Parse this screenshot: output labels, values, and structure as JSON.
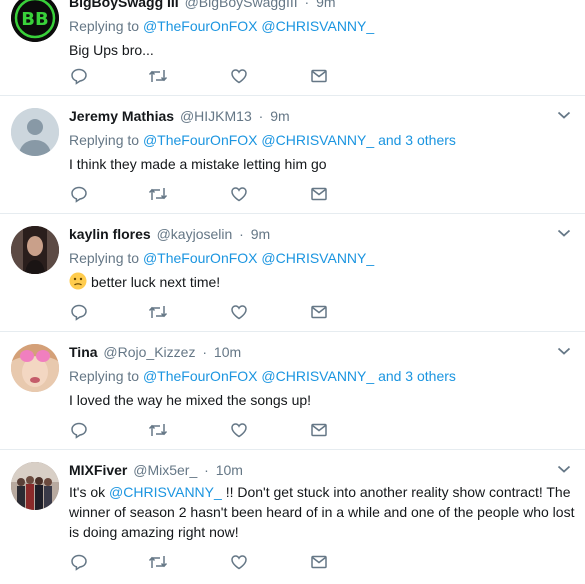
{
  "tweets": [
    {
      "name": "BigBoySwagg III",
      "handle": "@BigBoySwaggIII",
      "time": "9m",
      "replying_prefix": "Replying to",
      "mentions": [
        "@TheFourOnFOX",
        "@CHRISVANNY_"
      ],
      "others": "",
      "text": "Big Ups bro...",
      "avatar": "bb-logo-avatar"
    },
    {
      "name": "Jeremy Mathias",
      "handle": "@HIJKM13",
      "time": "9m",
      "replying_prefix": "Replying to",
      "mentions": [
        "@TheFourOnFOX",
        "@CHRISVANNY_"
      ],
      "others": "and 3 others",
      "text": "I think they made a mistake letting him go",
      "avatar": "default-avatar"
    },
    {
      "name": "kaylin flores",
      "handle": "@kayjoselin",
      "time": "9m",
      "replying_prefix": "Replying to",
      "mentions": [
        "@TheFourOnFOX",
        "@CHRISVANNY_"
      ],
      "others": "",
      "emoji": "confused-face",
      "text": "better luck next time!",
      "avatar": "photo-avatar"
    },
    {
      "name": "Tina",
      "handle": "@Rojo_Kizzez",
      "time": "10m",
      "replying_prefix": "Replying to",
      "mentions": [
        "@TheFourOnFOX",
        "@CHRISVANNY_"
      ],
      "others": "and 3 others",
      "text": "I loved the way he mixed the songs up!",
      "avatar": "photo-avatar"
    },
    {
      "name": "MIXFiver",
      "handle": "@Mix5er_",
      "time": "10m",
      "text_prefix": "It's ok",
      "text_mention": "@CHRISVANNY_",
      "text": "!! Don't get stuck into another reality show contract! The winner of season 2 hasn't been heard of in a while and one of the people who lost is doing amazing right now!",
      "avatar": "group-photo-avatar"
    }
  ],
  "actions": [
    "reply-icon",
    "retweet-icon",
    "like-icon",
    "message-icon"
  ],
  "colors": {
    "link": "#1b95e0",
    "secondary": "#657786",
    "icon": "#657786",
    "border": "#e6ecf0"
  }
}
